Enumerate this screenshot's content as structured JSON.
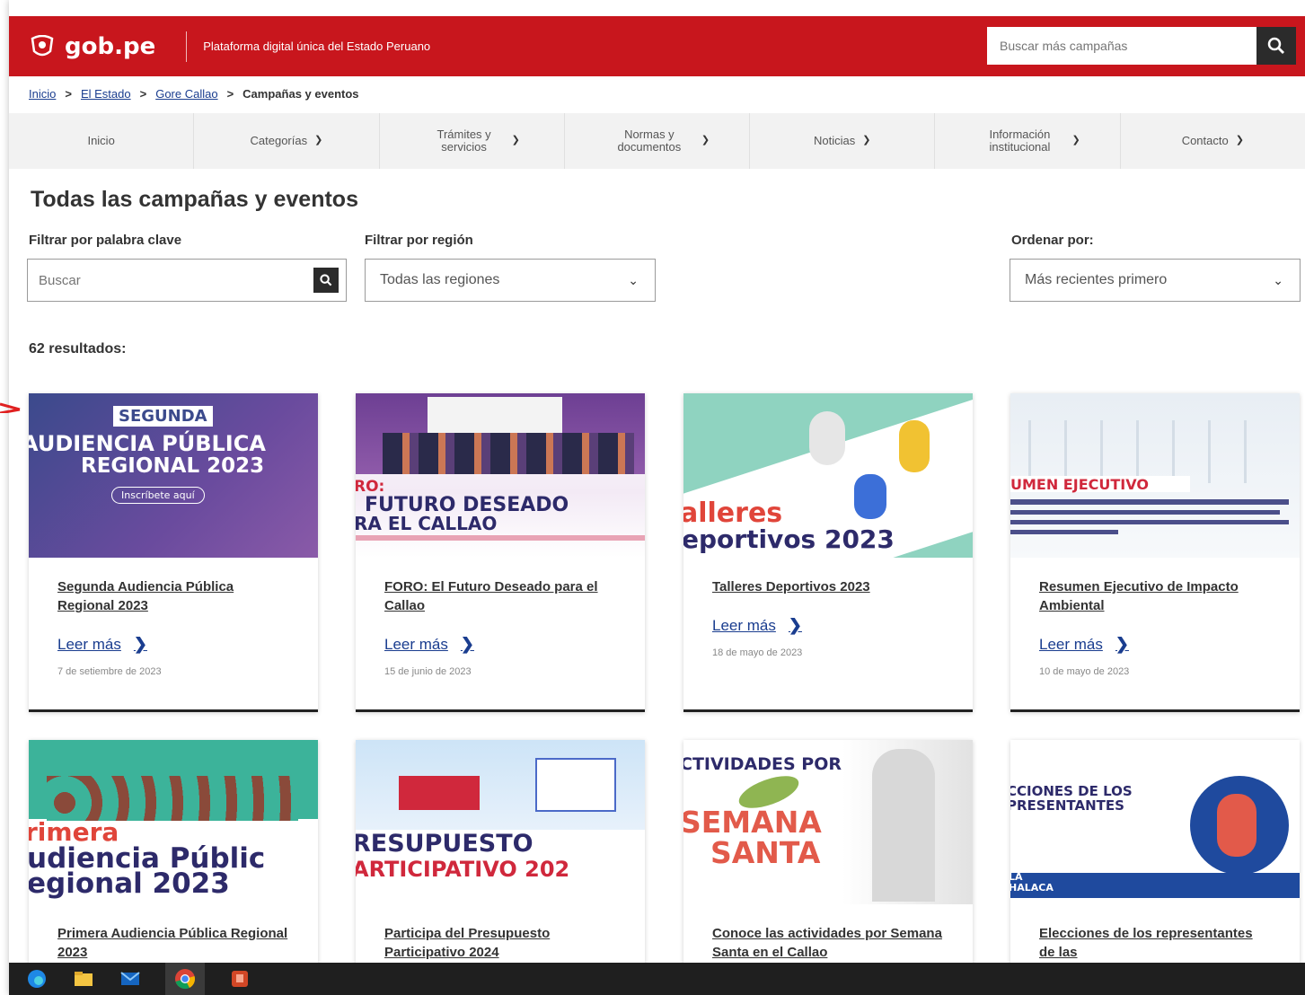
{
  "header": {
    "logo_text": "gob.pe",
    "tagline": "Plataforma digital única del Estado Peruano",
    "search_placeholder": "Buscar más campañas"
  },
  "breadcrumb": {
    "items": [
      "Inicio",
      "El Estado",
      "Gore Callao"
    ],
    "current": "Campañas y eventos"
  },
  "nav": {
    "items": [
      "Inicio",
      "Categorías",
      "Trámites y servicios",
      "Normas y documentos",
      "Noticias",
      "Información institucional",
      "Contacto"
    ]
  },
  "page": {
    "title": "Todas las campañas y eventos",
    "keyword_label": "Filtrar por palabra clave",
    "keyword_placeholder": "Buscar",
    "region_label": "Filtrar por región",
    "region_value": "Todas las regiones",
    "order_label": "Ordenar por:",
    "order_value": "Más recientes primero",
    "results": "62 resultados:"
  },
  "cards": [
    {
      "title": "Segunda Audiencia Pública Regional 2023",
      "more": "Leer más",
      "date": "7 de setiembre de 2023",
      "img": {
        "l1": "SEGUNDA",
        "l2": "AUDIENCIA PÚBLICA",
        "l3": "REGIONAL 2023",
        "l4": "Inscríbete aquí"
      }
    },
    {
      "title": "FORO: El Futuro Deseado para el Callao",
      "more": "Leer más",
      "date": "15 de junio de 2023",
      "img": {
        "l1": "RO:",
        "l2": "FUTURO DESEADO",
        "l3": "RA EL CALLAO"
      }
    },
    {
      "title": "Talleres Deportivos 2023",
      "more": "Leer más",
      "date": "18 de mayo de 2023",
      "img": {
        "l1": "alleres",
        "l2": "eportivos 2023"
      }
    },
    {
      "title": "Resumen Ejecutivo de Impacto Ambiental",
      "more": "Leer más",
      "date": "10 de mayo de 2023",
      "img": {
        "l1": "UMEN EJECUTIVO"
      }
    },
    {
      "title": "Primera Audiencia Pública Regional 2023",
      "img": {
        "l1": "rimera",
        "l2": "udiencia Públic",
        "l3": "egional 2023"
      }
    },
    {
      "title": "Participa del Presupuesto Participativo 2024",
      "img": {
        "l1": "RESUPUESTO",
        "l2": "ARTICIPATIVO 202"
      }
    },
    {
      "title": "Conoce las actividades por Semana Santa en el Callao",
      "img": {
        "l1": "CTIVIDADES POR",
        "l2": "SEMANA",
        "l3": "SANTA"
      }
    },
    {
      "title": "Elecciones de los representantes de las",
      "img": {
        "l1": "CCIONES DE LOS",
        "l2": "PRESENTANTES",
        "l3": "LA",
        "l4": "HALACA"
      }
    }
  ],
  "colors": {
    "brand_red": "#c8161d",
    "link_blue": "#1a3d8f"
  }
}
